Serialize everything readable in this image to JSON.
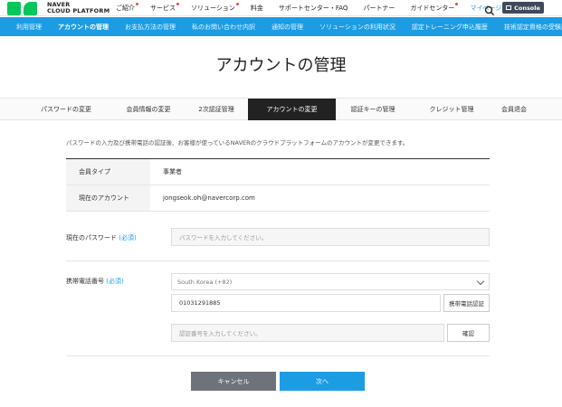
{
  "brand": {
    "line1": "NAVER",
    "line2": "CLOUD PLATFORM"
  },
  "top_menu": [
    {
      "label": "ご紹介",
      "dot": true
    },
    {
      "label": "サービス",
      "dot": true
    },
    {
      "label": "ソリューション",
      "dot": true
    },
    {
      "label": "料金",
      "dot": false
    },
    {
      "label": "サポートセンター・FAQ",
      "dot": false
    },
    {
      "label": "パートナー",
      "dot": false
    },
    {
      "label": "ガイドセンター",
      "dot": true
    },
    {
      "label": "マイページ",
      "dot": false,
      "active": true
    }
  ],
  "console_label": "Console",
  "sub_menu": [
    "利用管理",
    "アカウントの管理",
    "お支払方法の管理",
    "私のお問い合わせ内訳",
    "通知の管理",
    "ソリューションの利用状況",
    "認定トレーニング申込履歴",
    "技術認定資格の受験履歴"
  ],
  "sub_menu_active": "アカウントの管理",
  "page_title": "アカウントの管理",
  "tabs": [
    "パスワードの変更",
    "会員情報の変更",
    "2次認証管理",
    "アカウントの変更",
    "認証キーの管理",
    "クレジット管理",
    "会員退会"
  ],
  "active_tab": "アカウントの変更",
  "notice": "パスワードの入力及び携帯電話の認証後、お客様が使っているNAVERのクラウドプラットフォームのアカウントが変更できます。",
  "info": {
    "member_type_label": "会員タイプ",
    "member_type_value": "事業者",
    "current_account_label": "現在のアカウント",
    "current_account_value": "jongseok.oh@navercorp.com"
  },
  "form": {
    "password_label": "現在のパスワード",
    "required": "(必須)",
    "password_placeholder": "パスワードを入力してください。",
    "phone_label": "携帯電話番号",
    "country_selected": "South Korea (+82)",
    "phone_value": "01031291885",
    "phone_verify_button": "携帯電話認証",
    "code_placeholder": "認証番号を入力してください。",
    "confirm_button": "確認"
  },
  "actions": {
    "cancel": "キャンセル",
    "next": "次へ"
  },
  "colors": {
    "accent": "#1b9ce3",
    "brand_green": "#03c75a",
    "tab_active": "#222222",
    "cancel": "#6e7279"
  }
}
